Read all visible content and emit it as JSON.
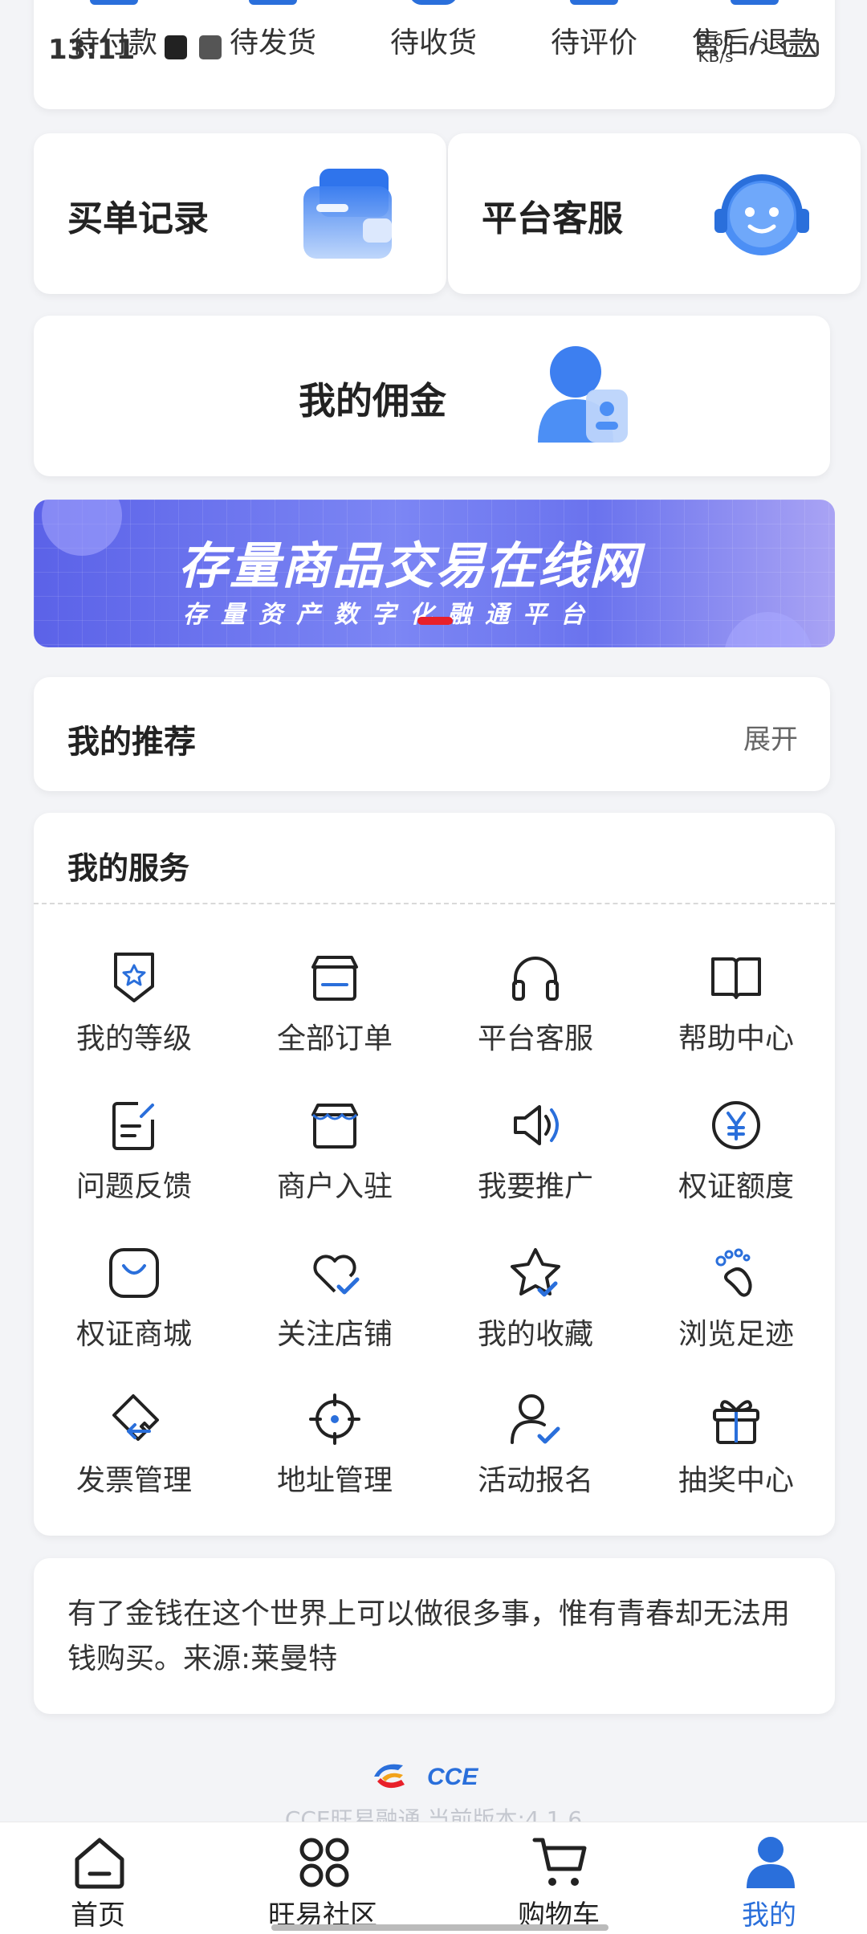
{
  "status_bar": {
    "time": "13:11",
    "net_speed": "0.60\nKB/s"
  },
  "orders": [
    {
      "label": "待付款",
      "icon": "wallet-icon"
    },
    {
      "label": "待发货",
      "icon": "box-icon"
    },
    {
      "label": "待收货",
      "icon": "truck-icon"
    },
    {
      "label": "待评价",
      "icon": "comment-icon"
    },
    {
      "label": "售后/退款",
      "icon": "refund-icon"
    }
  ],
  "quick_cards": {
    "purchase_records": "买单记录",
    "platform_service": "平台客服",
    "my_commission": "我的佣金"
  },
  "banner": {
    "title": "存量商品交易在线网",
    "subtitle": "存量资产数字化融通平台"
  },
  "recommend": {
    "title": "我的推荐",
    "expand": "展开"
  },
  "services": {
    "title": "我的服务",
    "items": [
      {
        "label": "我的等级",
        "icon": "level-badge-icon"
      },
      {
        "label": "全部订单",
        "icon": "store-icon"
      },
      {
        "label": "平台客服",
        "icon": "headset-icon"
      },
      {
        "label": "帮助中心",
        "icon": "book-icon"
      },
      {
        "label": "问题反馈",
        "icon": "feedback-icon"
      },
      {
        "label": "商户入驻",
        "icon": "merchant-icon"
      },
      {
        "label": "我要推广",
        "icon": "speaker-icon"
      },
      {
        "label": "权证额度",
        "icon": "yen-icon"
      },
      {
        "label": "权证商城",
        "icon": "bag-icon"
      },
      {
        "label": "关注店铺",
        "icon": "heart-check-icon"
      },
      {
        "label": "我的收藏",
        "icon": "star-check-icon"
      },
      {
        "label": "浏览足迹",
        "icon": "footprint-icon"
      },
      {
        "label": "发票管理",
        "icon": "invoice-icon"
      },
      {
        "label": "地址管理",
        "icon": "location-icon"
      },
      {
        "label": "活动报名",
        "icon": "user-check-icon"
      },
      {
        "label": "抽奖中心",
        "icon": "gift-icon"
      }
    ]
  },
  "quote": {
    "text": "有了金钱在这个世界上可以做很多事，惟有青春却无法用钱购买。来源:莱曼特"
  },
  "footer": {
    "logo_text": "CCE",
    "version": "CCE旺易融通   当前版本:4.1.6"
  },
  "bottom_nav": [
    {
      "label": "首页",
      "icon": "home-icon",
      "active": false
    },
    {
      "label": "旺易社区",
      "icon": "community-icon",
      "active": false
    },
    {
      "label": "购物车",
      "icon": "cart-icon",
      "active": false
    },
    {
      "label": "我的",
      "icon": "profile-icon",
      "active": true
    }
  ],
  "colors": {
    "accent": "#2a6fdb",
    "background": "#f3f4f7",
    "banner_red_dot": "#e8202a"
  }
}
